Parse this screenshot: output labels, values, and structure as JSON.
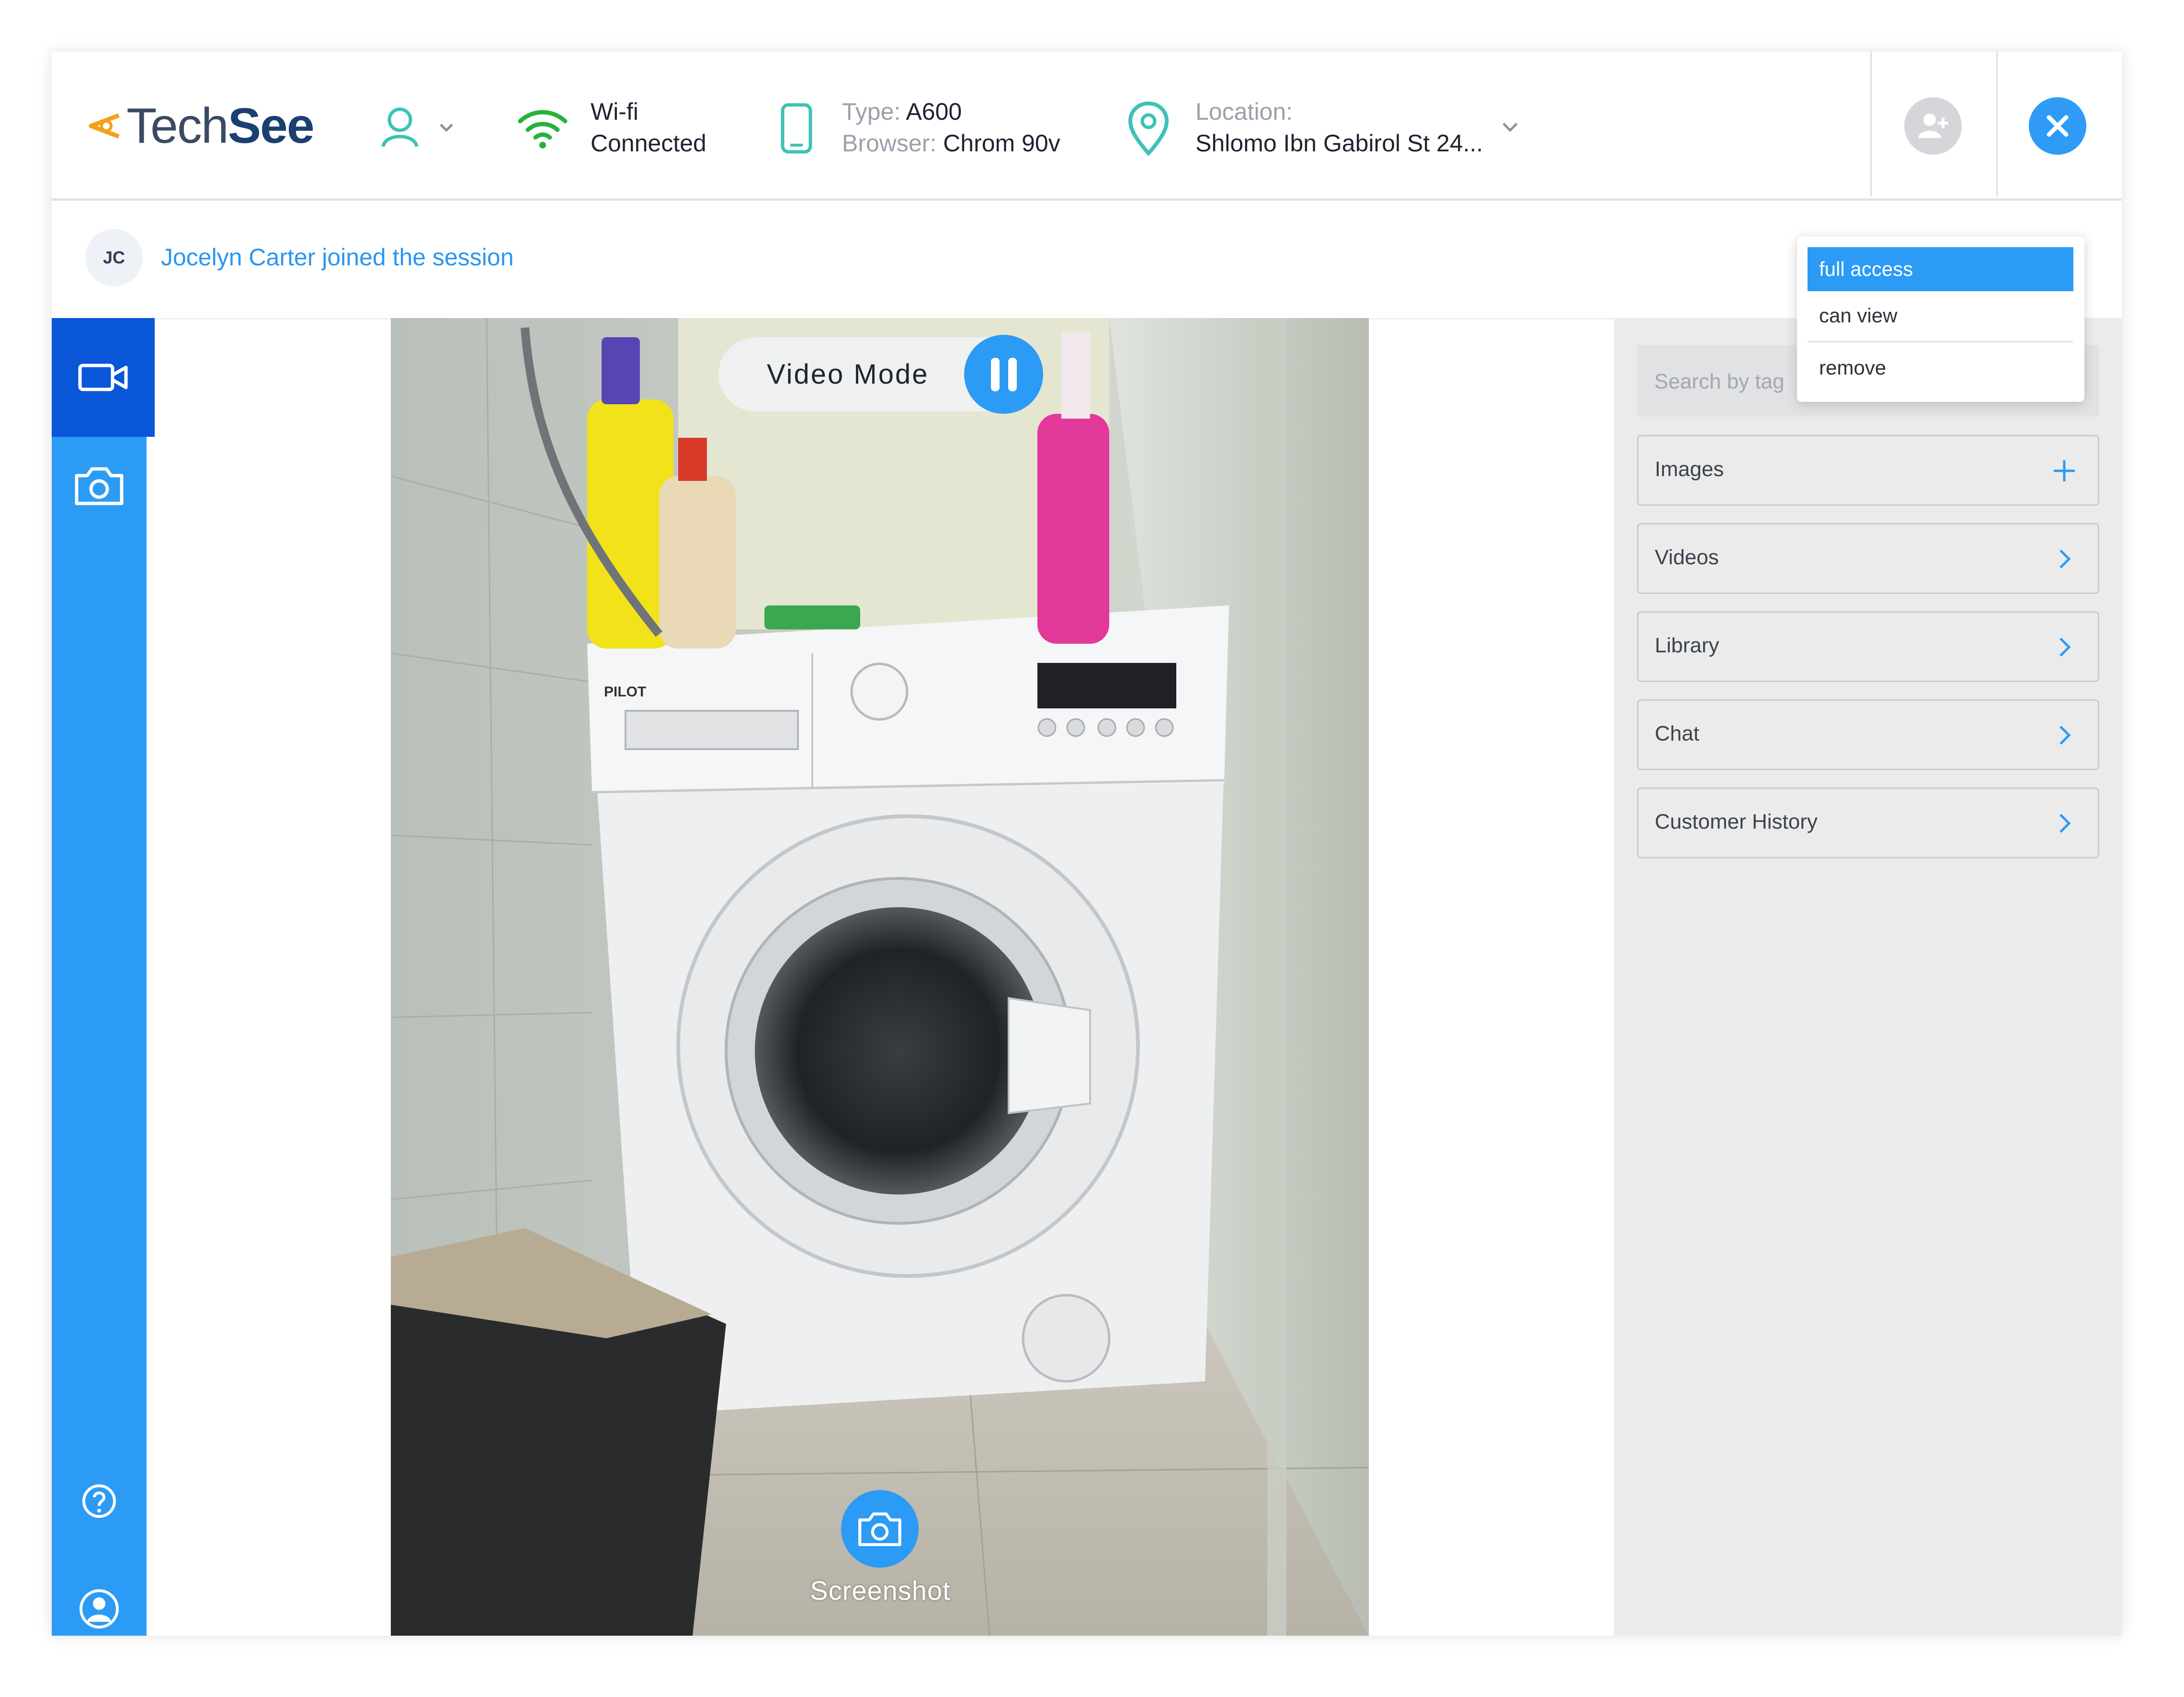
{
  "brand": {
    "part1": "Tech",
    "part2": "See"
  },
  "header": {
    "network": {
      "name": "Wi-fi",
      "status": "Connected"
    },
    "device": {
      "type_label": "Type:",
      "type_value": "A600",
      "browser_label": "Browser:",
      "browser_value": "Chrom 90v"
    },
    "location": {
      "label": "Location:",
      "value": "Shlomo Ibn Gabirol St 24..."
    }
  },
  "notification": {
    "initials": "JC",
    "text": "Jocelyn Carter joined the session"
  },
  "sidebar": {
    "items": [
      {
        "icon": "video-camera-icon",
        "active": true
      },
      {
        "icon": "camera-icon",
        "active": false
      },
      {
        "icon": "help-icon",
        "active": false
      },
      {
        "icon": "user-profile-icon",
        "active": false
      }
    ]
  },
  "video": {
    "mode_label": "Video Mode",
    "screenshot_label": "Screenshot"
  },
  "panel": {
    "search_placeholder": "Search by tag",
    "sections": [
      {
        "label": "Images",
        "icon": "plus-icon"
      },
      {
        "label": "Videos",
        "icon": "chevron-right-icon"
      },
      {
        "label": "Library",
        "icon": "chevron-right-icon"
      },
      {
        "label": "Chat",
        "icon": "chevron-right-icon"
      },
      {
        "label": "Customer History",
        "icon": "chevron-right-icon"
      }
    ]
  },
  "permissions_menu": {
    "options": [
      "full access",
      "can view",
      "remove"
    ],
    "selected": "full access"
  },
  "colors": {
    "accent": "#2b9bf5",
    "accent_dark": "#0a56d8",
    "wifi_green": "#26b33b",
    "teal": "#3cc3b4",
    "logo_orange": "#f2a218"
  }
}
